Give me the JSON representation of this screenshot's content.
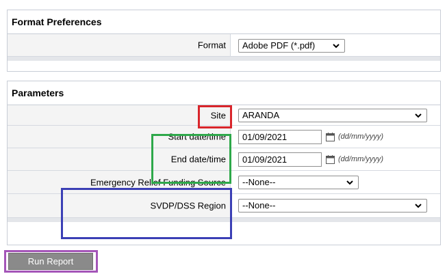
{
  "format_section": {
    "title": "Format Preferences",
    "format_label": "Format",
    "format_value": "Adobe PDF (*.pdf)"
  },
  "parameters_section": {
    "title": "Parameters",
    "site_label": "Site",
    "site_value": "ARANDA",
    "start_label": "Start date/time",
    "start_value": "01/09/2021",
    "end_label": "End date/time",
    "end_value": "01/09/2021",
    "date_hint": "(dd/mm/yyyy)",
    "funding_label": "Emergency Relief Funding Source",
    "funding_value": "--None--",
    "region_label": "SVDP/DSS Region",
    "region_value": "--None--"
  },
  "actions": {
    "run_report": "Run Report"
  },
  "colors": {
    "highlight_red": "#d9252b",
    "highlight_green": "#2ea84a",
    "highlight_blue": "#3b3fb5",
    "highlight_purple": "#a455b8",
    "button_gray": "#8a8a8a"
  },
  "icons": {
    "dropdown": "chevron-down-icon",
    "calendar": "calendar-icon"
  }
}
